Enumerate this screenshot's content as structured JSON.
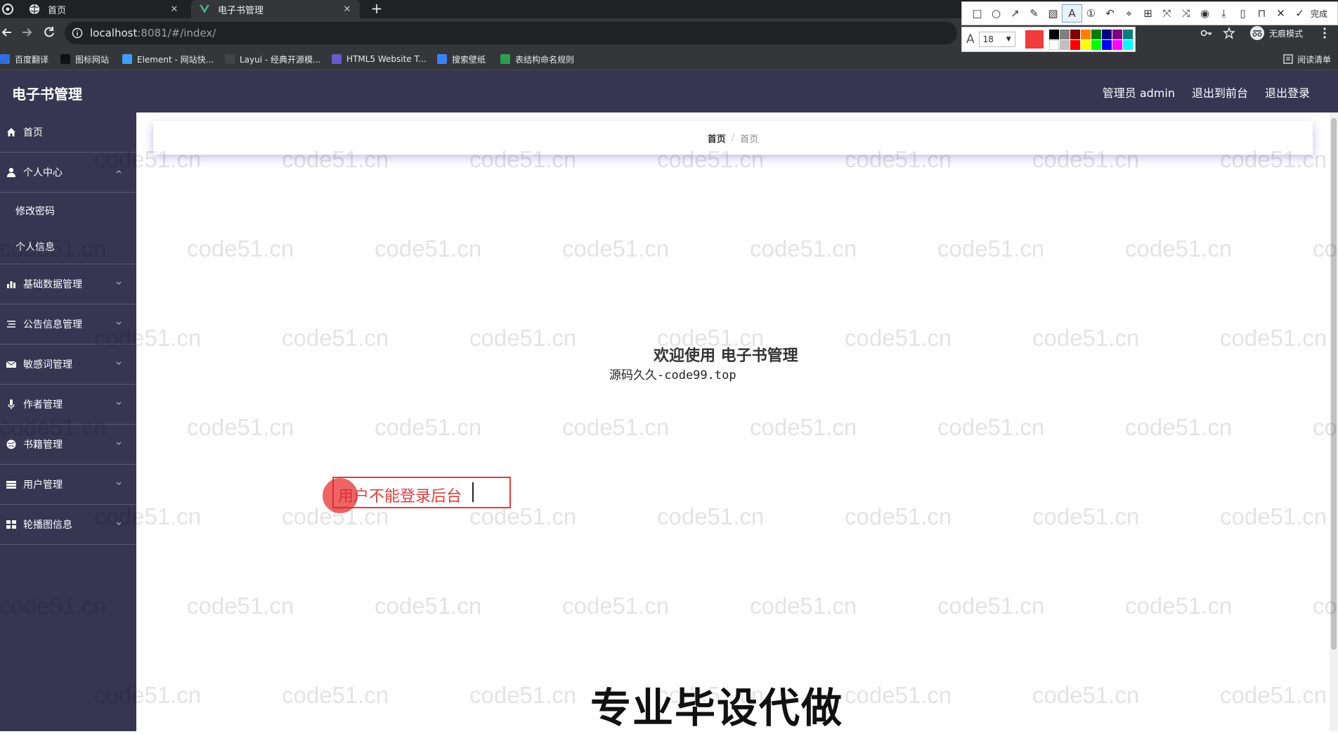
{
  "browser": {
    "tabs": [
      {
        "title": "首页"
      },
      {
        "title": "电子书管理"
      }
    ],
    "new_tab_label": "+",
    "url_host": "localhost",
    "url_path": ":8081/#/index/",
    "incognito_label": "无痕模式",
    "reader_label": "阅读清单",
    "bookmarks": [
      {
        "label": "百度翻译",
        "color": "#2f6fe0"
      },
      {
        "label": "图标网站",
        "color": "#111111"
      },
      {
        "label": "Element - 网站快...",
        "color": "#409eff"
      },
      {
        "label": "Layui - 经典开源模...",
        "color": "#444444"
      },
      {
        "label": "HTML5 Website T...",
        "color": "#6a5acd"
      },
      {
        "label": "搜索壁纸",
        "color": "#3b82f6"
      },
      {
        "label": "表结构命名规则",
        "color": "#2e9e4f"
      }
    ]
  },
  "snip_tool": {
    "done_label": "完成",
    "font_size": "18",
    "current_color": "#f23b3b",
    "palette": [
      "#000000",
      "#808080",
      "#800000",
      "#ff8000",
      "#008000",
      "#000080",
      "#800080",
      "#008080",
      "#ffffff",
      "#c0c0c0",
      "#ff0000",
      "#ffff00",
      "#00ff00",
      "#0000ff",
      "#ff00ff",
      "#00ffff"
    ]
  },
  "app": {
    "title": "电子书管理",
    "header_links": [
      "管理员 admin",
      "退出到前台",
      "退出登录"
    ],
    "menu": [
      {
        "label": "首页",
        "icon": "home-icon"
      },
      {
        "label": "个人中心",
        "icon": "user-icon",
        "expanded": true,
        "children": [
          "修改密码",
          "个人信息"
        ]
      },
      {
        "label": "基础数据管理",
        "icon": "bar-chart-icon"
      },
      {
        "label": "公告信息管理",
        "icon": "list-icon"
      },
      {
        "label": "敏感词管理",
        "icon": "envelope-icon"
      },
      {
        "label": "作者管理",
        "icon": "microphone-icon"
      },
      {
        "label": "书籍管理",
        "icon": "globe-icon"
      },
      {
        "label": "用户管理",
        "icon": "stack-icon"
      },
      {
        "label": "轮播图信息",
        "icon": "grid-icon"
      }
    ],
    "breadcrumb": {
      "home": "首页",
      "separator": "/",
      "current": "首页"
    },
    "welcome": "欢迎使用 电子书管理",
    "source_note": "源码久久-code99.top"
  },
  "annotation": {
    "text": "用户不能登录后台",
    "color": "#e23b3b"
  },
  "promo_caption": "专业毕设代做",
  "watermark": "code51.cn"
}
